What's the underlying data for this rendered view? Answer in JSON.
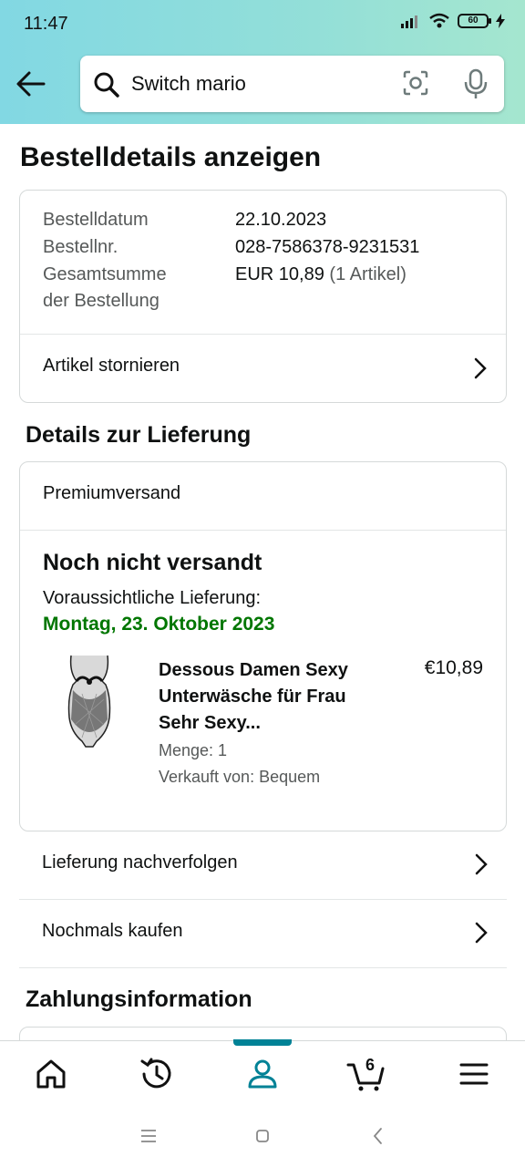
{
  "status_bar": {
    "time": "11:47",
    "battery": "60"
  },
  "search": {
    "query": "Switch mario"
  },
  "page": {
    "title": "Bestelldetails anzeigen"
  },
  "order": {
    "rows": [
      {
        "label": "Bestelldatum",
        "value": "22.10.2023"
      },
      {
        "label": "Bestellnr.",
        "value": "028-7586378-9231531"
      }
    ],
    "total_label_line1": "Gesamtsumme",
    "total_label_line2": "der Bestellung",
    "total_value": "EUR 10,89",
    "total_count": "(1 Artikel)",
    "cancel_label": "Artikel stornieren"
  },
  "delivery": {
    "section_title": "Details zur Lieferung",
    "shipping_method": "Premiumversand",
    "status": "Noch nicht versandt",
    "eta_label": "Voraussichtliche Lieferung:",
    "eta_date": "Montag, 23. Oktober 2023",
    "item": {
      "name": "Dessous Damen Sexy Unterwäsche für Frau Sehr Sexy...",
      "price": "€10,89",
      "quantity": "Menge: 1",
      "seller": "Verkauft von: Bequem"
    }
  },
  "actions": {
    "track": "Lieferung nachverfolgen",
    "buy_again": "Nochmals kaufen"
  },
  "payment": {
    "section_title": "Zahlungsinformation"
  },
  "bottom_nav": {
    "items": [
      "home-icon",
      "history-icon",
      "account-icon",
      "cart-icon",
      "menu-icon"
    ],
    "cart_count": "6",
    "active": "account",
    "accent_color": "#008296"
  },
  "colors": {
    "delivery_green": "#007600",
    "header_gradient_start": "#82d8e3",
    "header_gradient_end": "#a5e6cf"
  }
}
